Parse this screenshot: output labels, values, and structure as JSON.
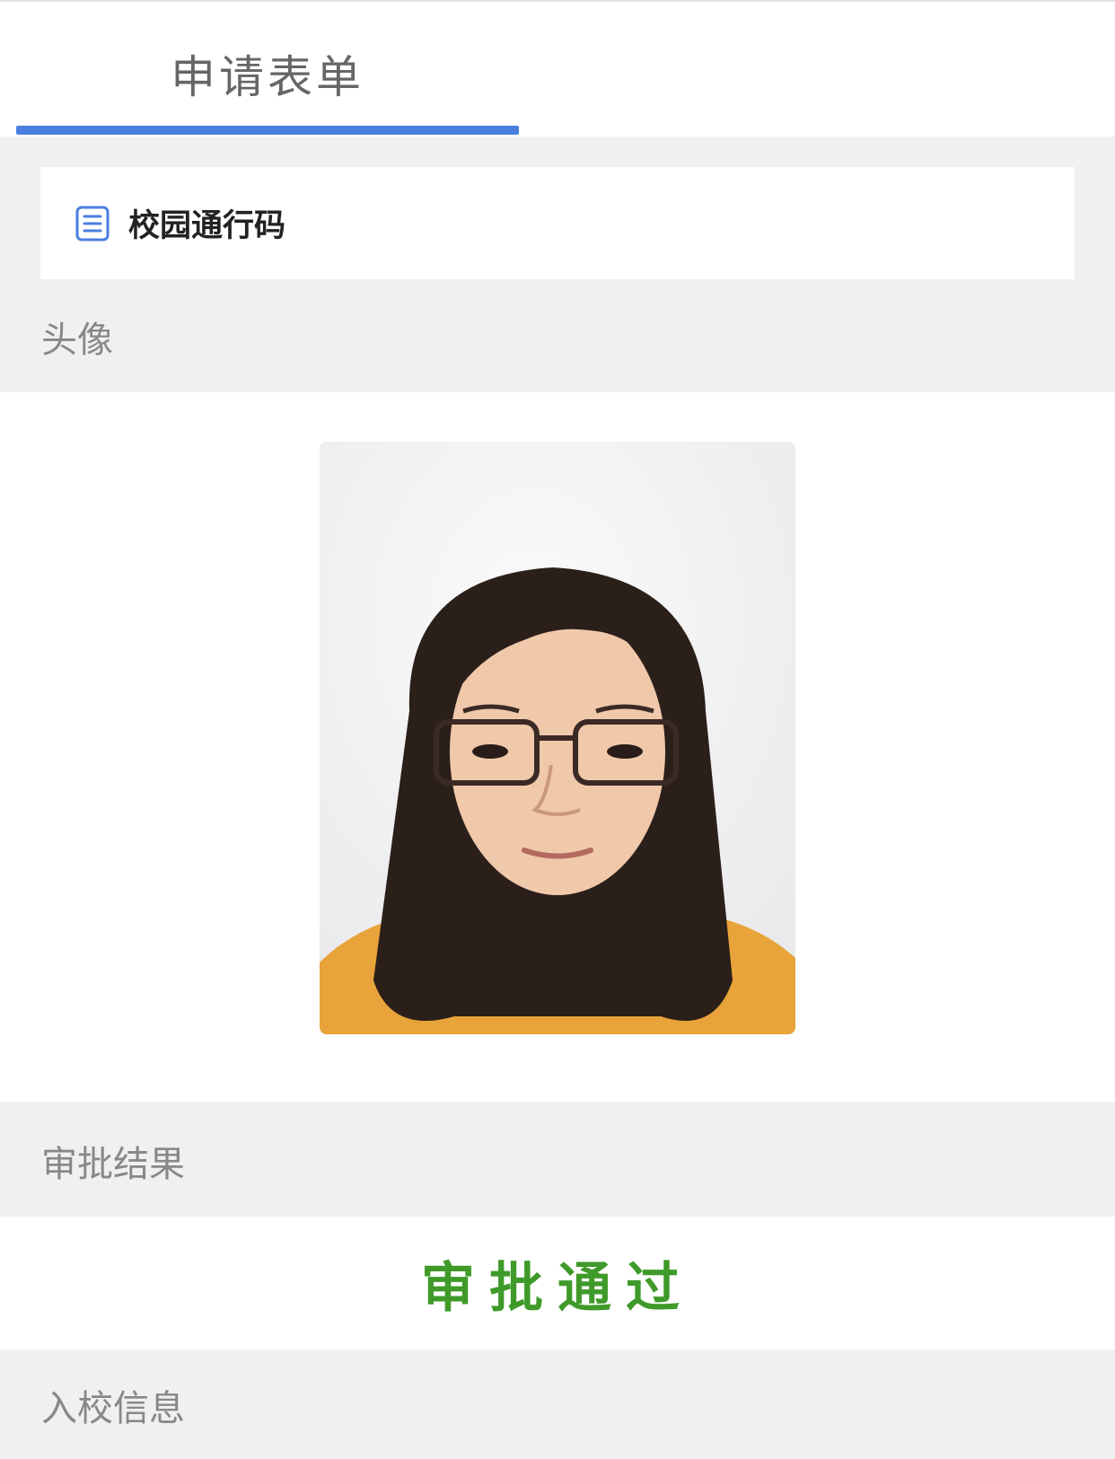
{
  "tabs": [
    {
      "label": "申请表单",
      "active": true
    }
  ],
  "form": {
    "title": "校园通行码",
    "icon": "document-icon"
  },
  "sections": {
    "avatar_label": "头像",
    "approval_label": "审批结果",
    "approval_status": "审批通过",
    "entry_info_label": "入校信息"
  },
  "colors": {
    "accent": "#4a7fe0",
    "approved": "#3f9a29",
    "label": "#888888",
    "background": "#f0f0f0"
  }
}
